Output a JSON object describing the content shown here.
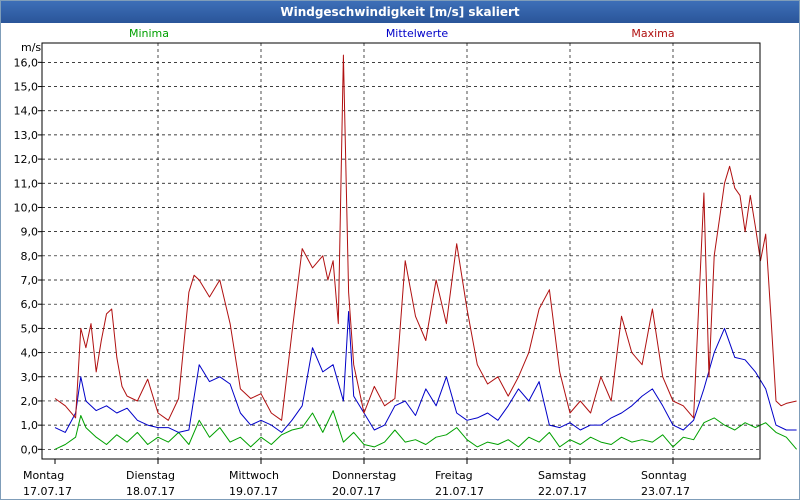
{
  "window": {
    "title": "Windgeschwindigkeit [m/s] skaliert"
  },
  "chart_data": {
    "type": "line",
    "ylabel": "m/s",
    "ylim": [
      -0.4,
      16.8
    ],
    "yticks": [
      "0,0",
      "1,0",
      "2,0",
      "3,0",
      "4,0",
      "5,0",
      "6,0",
      "7,0",
      "8,0",
      "9,0",
      "10,0",
      "11,0",
      "12,0",
      "13,0",
      "14,0",
      "15,0",
      "16,0"
    ],
    "xlim": [
      0,
      7.2
    ],
    "days": [
      {
        "name": "Montag",
        "date": "17.07.17"
      },
      {
        "name": "Dienstag",
        "date": "18.07.17"
      },
      {
        "name": "Mittwoch",
        "date": "19.07.17"
      },
      {
        "name": "Donnerstag",
        "date": "20.07.17"
      },
      {
        "name": "Freitag",
        "date": "21.07.17"
      },
      {
        "name": "Samstag",
        "date": "22.07.17"
      },
      {
        "name": "Sonntag",
        "date": "23.07.17"
      }
    ],
    "grid": true,
    "legend_position": "top",
    "series": [
      {
        "name": "Minima",
        "color": "#00a000",
        "x": [
          0,
          0.1,
          0.2,
          0.25,
          0.3,
          0.4,
          0.5,
          0.6,
          0.7,
          0.8,
          0.9,
          1.0,
          1.1,
          1.2,
          1.3,
          1.4,
          1.5,
          1.6,
          1.7,
          1.8,
          1.9,
          2.0,
          2.1,
          2.2,
          2.3,
          2.4,
          2.5,
          2.6,
          2.7,
          2.8,
          2.9,
          3.0,
          3.1,
          3.2,
          3.3,
          3.4,
          3.5,
          3.6,
          3.7,
          3.8,
          3.9,
          4.0,
          4.1,
          4.2,
          4.3,
          4.4,
          4.5,
          4.6,
          4.7,
          4.8,
          4.9,
          5.0,
          5.1,
          5.2,
          5.3,
          5.4,
          5.5,
          5.6,
          5.7,
          5.8,
          5.9,
          6.0,
          6.1,
          6.2,
          6.3,
          6.4,
          6.5,
          6.6,
          6.7,
          6.8,
          6.9,
          7.0,
          7.1,
          7.2
        ],
        "y": [
          0,
          0.2,
          0.5,
          1.4,
          0.9,
          0.5,
          0.2,
          0.6,
          0.3,
          0.7,
          0.2,
          0.5,
          0.3,
          0.7,
          0.2,
          1.2,
          0.5,
          0.9,
          0.3,
          0.5,
          0.1,
          0.5,
          0.2,
          0.6,
          0.8,
          0.9,
          1.5,
          0.7,
          1.6,
          0.3,
          0.7,
          0.2,
          0.1,
          0.3,
          0.8,
          0.3,
          0.4,
          0.2,
          0.5,
          0.6,
          0.9,
          0.4,
          0.1,
          0.3,
          0.2,
          0.4,
          0.1,
          0.5,
          0.3,
          0.7,
          0.1,
          0.4,
          0.2,
          0.5,
          0.3,
          0.2,
          0.5,
          0.3,
          0.4,
          0.3,
          0.6,
          0.1,
          0.5,
          0.4,
          1.1,
          1.3,
          1.0,
          0.8,
          1.1,
          0.9,
          1.1,
          0.7,
          0.5,
          0.0
        ]
      },
      {
        "name": "Mittelwerte",
        "color": "#0000c8",
        "x": [
          0,
          0.1,
          0.2,
          0.25,
          0.3,
          0.4,
          0.5,
          0.6,
          0.7,
          0.8,
          0.9,
          1.0,
          1.1,
          1.2,
          1.3,
          1.4,
          1.5,
          1.6,
          1.7,
          1.8,
          1.9,
          2.0,
          2.1,
          2.2,
          2.3,
          2.4,
          2.5,
          2.6,
          2.7,
          2.8,
          2.85,
          2.9,
          3.0,
          3.1,
          3.2,
          3.3,
          3.4,
          3.5,
          3.6,
          3.7,
          3.8,
          3.9,
          4.0,
          4.1,
          4.2,
          4.3,
          4.4,
          4.5,
          4.6,
          4.7,
          4.8,
          4.9,
          5.0,
          5.1,
          5.2,
          5.3,
          5.4,
          5.5,
          5.6,
          5.7,
          5.8,
          5.9,
          6.0,
          6.1,
          6.2,
          6.3,
          6.4,
          6.5,
          6.6,
          6.7,
          6.8,
          6.9,
          7.0,
          7.1,
          7.2
        ],
        "y": [
          0.9,
          0.7,
          1.5,
          3.0,
          2.0,
          1.6,
          1.8,
          1.5,
          1.7,
          1.2,
          1.0,
          0.9,
          0.9,
          0.7,
          0.8,
          3.5,
          2.8,
          3.0,
          2.7,
          1.5,
          1.0,
          1.2,
          1.0,
          0.7,
          1.2,
          1.8,
          4.2,
          3.2,
          3.5,
          2.0,
          5.7,
          2.2,
          1.5,
          0.8,
          1.0,
          1.8,
          2.0,
          1.4,
          2.5,
          1.8,
          3.0,
          1.5,
          1.2,
          1.3,
          1.5,
          1.2,
          1.8,
          2.5,
          2.0,
          2.8,
          1.0,
          0.9,
          1.1,
          0.8,
          1.0,
          1.0,
          1.3,
          1.5,
          1.8,
          2.2,
          2.5,
          1.8,
          1.0,
          0.8,
          1.2,
          2.5,
          4.0,
          5.0,
          3.8,
          3.7,
          3.2,
          2.5,
          1.0,
          0.8,
          0.8
        ]
      },
      {
        "name": "Maxima",
        "color": "#b01010",
        "x": [
          0,
          0.1,
          0.2,
          0.25,
          0.3,
          0.35,
          0.4,
          0.45,
          0.5,
          0.55,
          0.6,
          0.65,
          0.7,
          0.8,
          0.9,
          1.0,
          1.1,
          1.2,
          1.3,
          1.35,
          1.4,
          1.5,
          1.6,
          1.7,
          1.8,
          1.9,
          2.0,
          2.1,
          2.2,
          2.3,
          2.4,
          2.5,
          2.6,
          2.65,
          2.7,
          2.75,
          2.8,
          2.85,
          2.9,
          3.0,
          3.1,
          3.2,
          3.3,
          3.4,
          3.5,
          3.6,
          3.7,
          3.8,
          3.9,
          4.0,
          4.1,
          4.2,
          4.3,
          4.4,
          4.5,
          4.6,
          4.7,
          4.8,
          4.9,
          5.0,
          5.1,
          5.2,
          5.3,
          5.4,
          5.5,
          5.6,
          5.7,
          5.8,
          5.9,
          6.0,
          6.1,
          6.2,
          6.3,
          6.35,
          6.4,
          6.45,
          6.5,
          6.55,
          6.6,
          6.65,
          6.7,
          6.75,
          6.8,
          6.85,
          6.9,
          6.95,
          7.0,
          7.05,
          7.1,
          7.2
        ],
        "y": [
          2.1,
          1.8,
          1.3,
          5.0,
          4.2,
          5.2,
          3.2,
          4.5,
          5.6,
          5.8,
          3.8,
          2.6,
          2.2,
          2.0,
          2.9,
          1.5,
          1.2,
          2.1,
          6.5,
          7.2,
          7.0,
          6.3,
          7.0,
          5.2,
          2.5,
          2.1,
          2.3,
          1.5,
          1.2,
          4.8,
          8.3,
          7.5,
          8.0,
          7.0,
          7.8,
          5.2,
          16.3,
          6.5,
          3.5,
          1.5,
          2.6,
          1.8,
          2.1,
          7.8,
          5.5,
          4.5,
          7.0,
          5.2,
          8.5,
          5.8,
          3.5,
          2.7,
          3.0,
          2.2,
          3.0,
          4.0,
          5.8,
          6.6,
          3.2,
          1.5,
          2.0,
          1.5,
          3.0,
          2.0,
          5.5,
          4.0,
          3.5,
          5.8,
          3.0,
          2.0,
          1.8,
          1.3,
          10.6,
          3.0,
          8.0,
          9.5,
          11.0,
          11.7,
          10.8,
          10.5,
          9.0,
          10.5,
          9.2,
          7.8,
          8.9,
          5.5,
          2.0,
          1.8,
          1.9,
          2.0
        ]
      }
    ]
  }
}
